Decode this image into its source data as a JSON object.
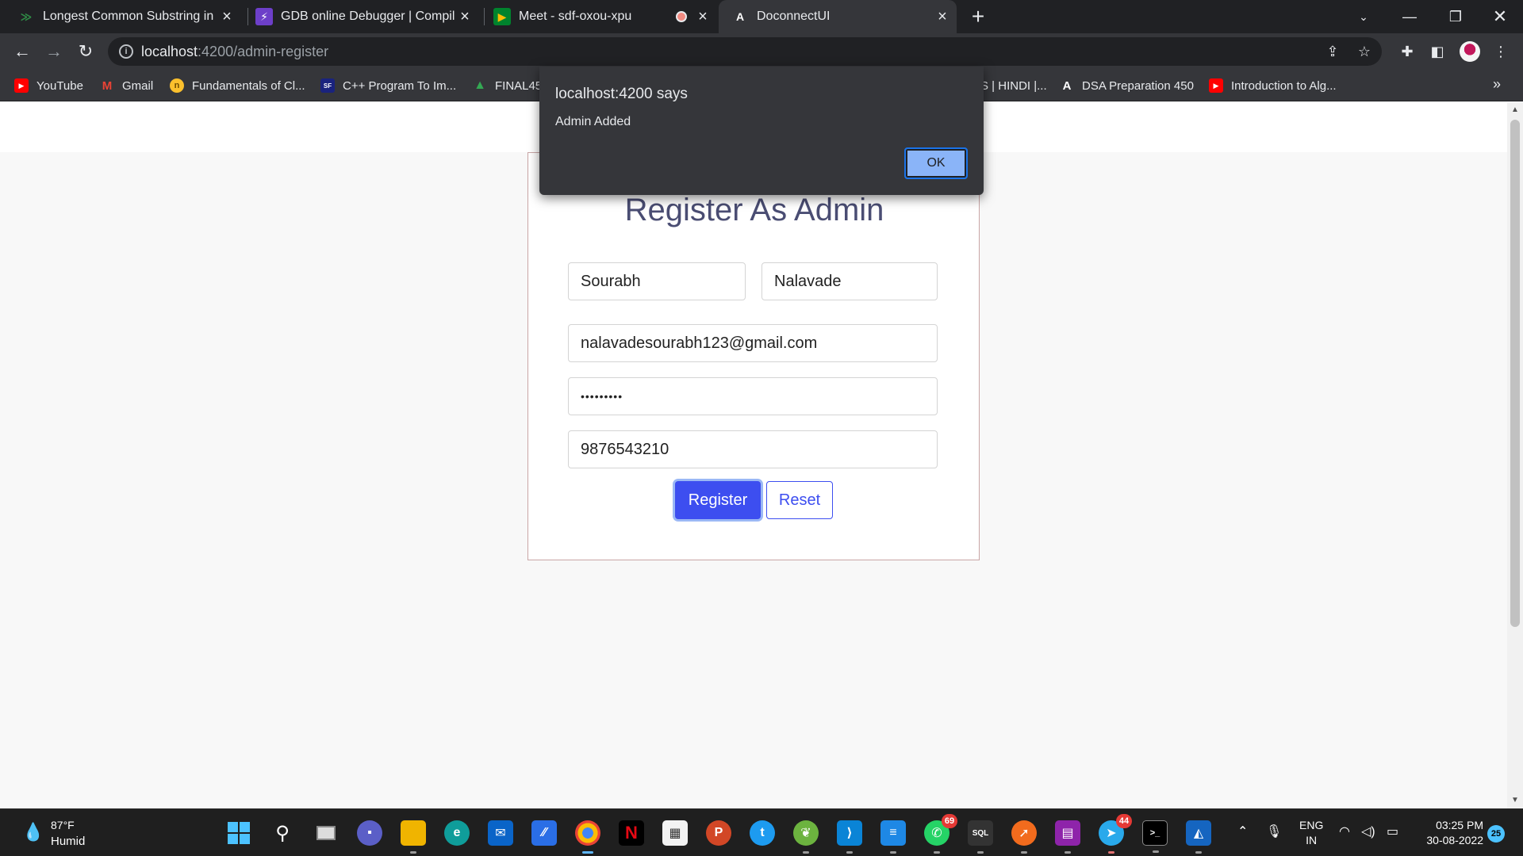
{
  "browser": {
    "tabs": [
      {
        "title": "Longest Common Substring in ar",
        "icon": "gfg-icon"
      },
      {
        "title": "GDB online Debugger | Compiler",
        "icon": "gdb-icon"
      },
      {
        "title": "Meet - sdf-oxou-xpu",
        "icon": "meet-icon"
      },
      {
        "title": "DoconnectUI",
        "icon": "angular-icon"
      }
    ],
    "url_host": "localhost",
    "url_path": ":4200/admin-register",
    "bookmarks": [
      {
        "label": "YouTube",
        "icon": "youtube-icon"
      },
      {
        "label": "Gmail",
        "icon": "gmail-icon"
      },
      {
        "label": "Fundamentals of Cl...",
        "icon": "globe-icon"
      },
      {
        "label": "C++ Program To Im...",
        "icon": "site-icon"
      },
      {
        "label": "FINAL45",
        "icon": "drive-icon"
      },
      {
        "label": "S | HINDI |...",
        "icon": "site-icon"
      },
      {
        "label": "DSA Preparation 450",
        "icon": "angular-icon"
      },
      {
        "label": "Introduction to Alg...",
        "icon": "youtube-icon"
      }
    ],
    "more": "»"
  },
  "alert": {
    "header": "localhost:4200 says",
    "message": "Admin Added",
    "ok_label": "OK"
  },
  "form": {
    "title": "Register As Admin",
    "first_name": "Sourabh",
    "last_name": "Nalavade",
    "email": "nalavadesourabh123@gmail.com",
    "password": "•••••••••",
    "phone": "9876543210",
    "register_label": "Register",
    "reset_label": "Reset"
  },
  "taskbar": {
    "weather_temp": "87°F",
    "weather_cond": "Humid",
    "whatsapp_badge": "69",
    "telegram_badge": "44",
    "lang_line1": "ENG",
    "lang_line2": "IN",
    "time": "03:25 PM",
    "date": "30-08-2022",
    "notifications": "25"
  },
  "colors": {
    "accent": "#3d4ef0",
    "title": "#4a4d73",
    "chrome_dark": "#202124"
  }
}
